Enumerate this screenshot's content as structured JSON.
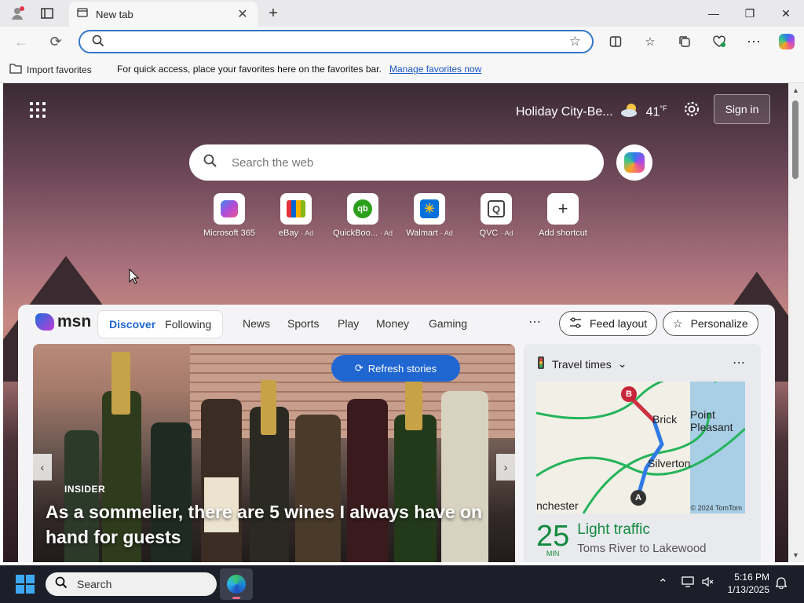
{
  "browser": {
    "tab_title": "New tab",
    "address_value": "",
    "favorites_import": "Import favorites",
    "favorites_message": "For quick access, place your favorites here on the favorites bar.",
    "favorites_link": "Manage favorites now"
  },
  "newtab": {
    "location": "Holiday City-Be...",
    "temperature": "41",
    "temperature_unit": "°F",
    "sign_in": "Sign in",
    "search_placeholder": "Search the web",
    "shortcuts": [
      {
        "label": "Microsoft 365",
        "ad": "",
        "icon": "m365-icon"
      },
      {
        "label": "eBay",
        "ad": "· Ad",
        "icon": "ebay-icon"
      },
      {
        "label": "QuickBoo...",
        "ad": "· Ad",
        "icon": "quickbooks-icon"
      },
      {
        "label": "Walmart",
        "ad": "· Ad",
        "icon": "walmart-icon"
      },
      {
        "label": "QVC",
        "ad": "· Ad",
        "icon": "qvc-icon"
      },
      {
        "label": "Add shortcut",
        "ad": "",
        "icon": "plus-icon"
      }
    ]
  },
  "feed": {
    "brand": "msn",
    "tabs": [
      "Discover",
      "Following"
    ],
    "active_tab": "Discover",
    "categories": [
      "News",
      "Sports",
      "Play",
      "Money",
      "Gaming"
    ],
    "feed_layout": "Feed layout",
    "personalize": "Personalize",
    "refresh": "Refresh stories",
    "hero": {
      "source": "INSIDER",
      "headline": "As a sommelier, there are 5 wines I always have on hand for guests"
    },
    "travel": {
      "title": "Travel times",
      "map_labels": [
        "Brick",
        "Point Pleasant",
        "Silverton",
        "nchester"
      ],
      "map_copyright": "© 2024 TomTom",
      "minutes": "25",
      "minutes_unit": "MIN",
      "status": "Light traffic",
      "route": "Toms River to Lakewood"
    }
  },
  "taskbar": {
    "search_placeholder": "Search",
    "time": "5:16 PM",
    "date": "1/13/2025"
  },
  "colors": {
    "accent": "#1f66d1",
    "traffic_green": "#138a3f"
  }
}
